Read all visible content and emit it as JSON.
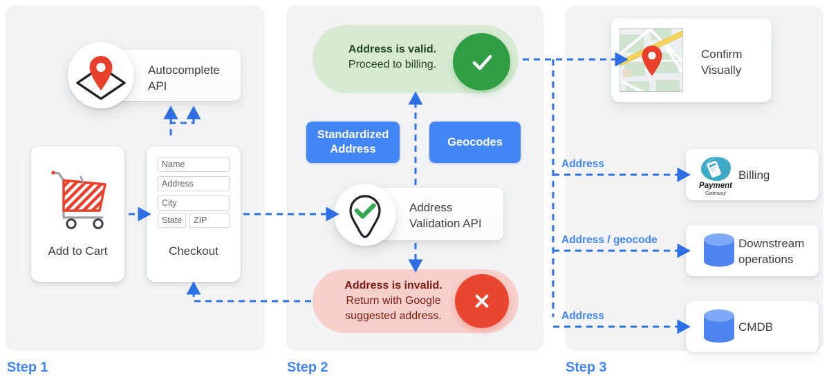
{
  "steps": [
    {
      "label": "Step 1"
    },
    {
      "label": "Step 2"
    },
    {
      "label": "Step 3"
    }
  ],
  "step1": {
    "autocomplete_api": "Autocomplete\nAPI",
    "add_to_cart": "Add to Cart",
    "checkout": "Checkout",
    "form_fields": [
      {
        "name": "name",
        "placeholder": "Name"
      },
      {
        "name": "address",
        "placeholder": "Address"
      },
      {
        "name": "city",
        "placeholder": "City"
      },
      {
        "name": "state",
        "placeholder": "State"
      },
      {
        "name": "zip",
        "placeholder": "ZIP"
      }
    ]
  },
  "step2": {
    "valid": {
      "line1": "Address is valid.",
      "line2": "Proceed to billing.",
      "icon": "check-icon",
      "bg_color": "#d9ead3",
      "circle_color": "#2f9e44",
      "text_color": "#1e4620"
    },
    "invalid": {
      "line1": "Address is invalid.",
      "line2": "Return with Google",
      "line3": "suggested address.",
      "icon": "close-icon",
      "bg_color": "#f7cfcb",
      "circle_color": "#e8462f",
      "text_color": "#7b1c12"
    },
    "standardized_address": "Standardized\nAddress",
    "geocodes": "Geocodes",
    "validation_api": "Address\nValidation API",
    "button_color": "#4285f4"
  },
  "step3": {
    "confirm_visually": "Confirm\nVisually",
    "destinations": [
      {
        "edge_label": "Address",
        "title": "Billing",
        "icon": "payment-gateway-logo",
        "logo_text_1": "Payment",
        "logo_text_2": "Gateway"
      },
      {
        "edge_label": "Address / geocode",
        "title": "Downstream\noperations",
        "icon": "database-icon"
      },
      {
        "edge_label": "Address",
        "title": "CMDB",
        "icon": "database-icon"
      }
    ]
  },
  "theme": {
    "accent_blue": "#4285f4",
    "panel_bg": "#f1f3f4",
    "pin_red": "#e8402a",
    "database_blue": "#5b8def",
    "payment_teal": "#3fa9c8"
  }
}
